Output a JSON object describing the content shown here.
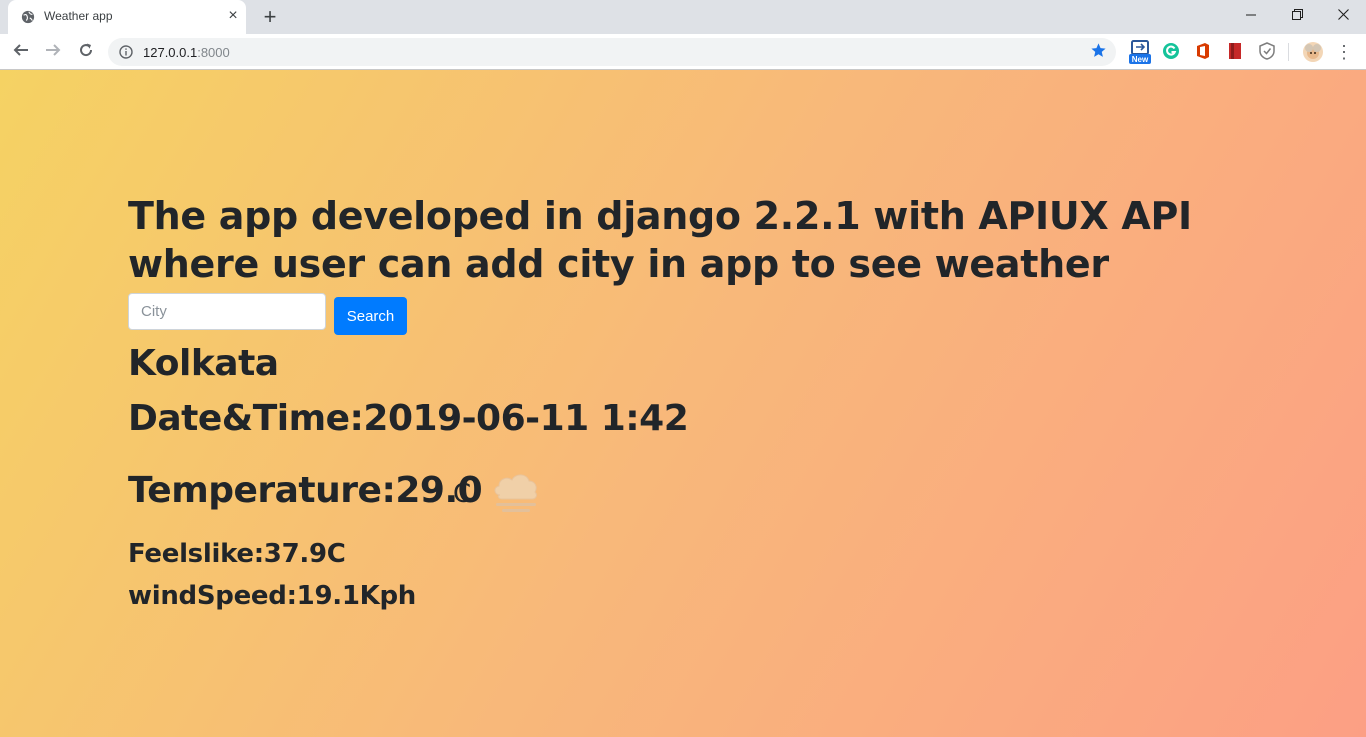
{
  "browser": {
    "tab_title": "Weather app",
    "tab_icon": "globe-icon",
    "close_tab": "×",
    "new_tab": "+",
    "window_controls": {
      "minimize": "—",
      "maximize": "❐",
      "close": "✕"
    },
    "nav": {
      "back": "←",
      "forward": "→",
      "reload": "↻"
    },
    "url_host": "127.0.0.1",
    "url_port": ":8000",
    "extensions": [
      "new-badge-extension-icon",
      "grammarly-icon",
      "office-icon",
      "bookmark-red-icon",
      "shield-icon",
      "profile-avatar-icon"
    ],
    "new_badge": "New",
    "menu": "⋮",
    "accent_color": "#1a73e8"
  },
  "page": {
    "headline": "The app developed in django 2.2.1 with APIUX API where user can add city in app to see weather info...",
    "search": {
      "placeholder": "City",
      "button_label": "Search",
      "button_color": "#007bff"
    },
    "city": "Kolkata",
    "datetime": "Date&Time:2019-06-11 1:42",
    "temperature": "Temperature:29.0",
    "temperature_unit": "C",
    "weather_icon": "cloud-fog-icon",
    "feelslike": "Feelslike:37.9C",
    "windspeed": "windSpeed:19.1Kph",
    "background_gradient": [
      "#f5d263",
      "#f8b87a",
      "#fc9f84"
    ]
  }
}
